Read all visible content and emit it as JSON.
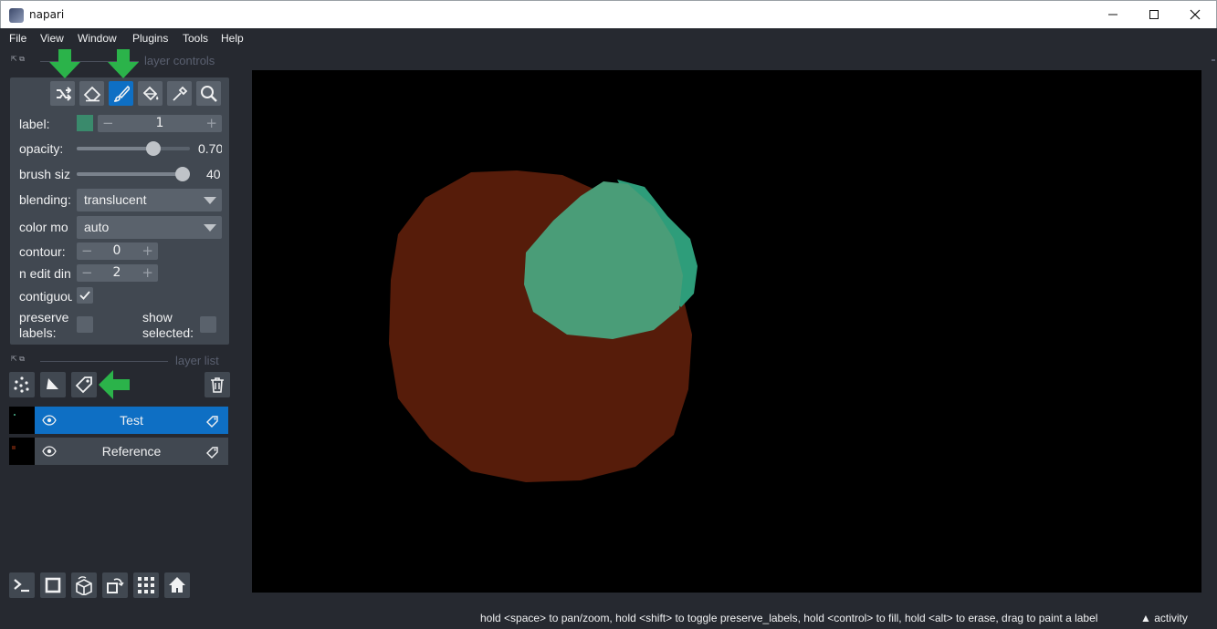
{
  "window": {
    "title": "napari"
  },
  "menu": [
    "File",
    "View",
    "Window",
    "Plugins",
    "Tools",
    "Help"
  ],
  "dock": {
    "layer_controls_title": "layer controls",
    "layer_list_title": "layer list"
  },
  "tools": [
    "shuffle-icon",
    "eraser-icon",
    "paintbrush-icon",
    "fill-bucket-icon",
    "color-picker-icon",
    "zoom-icon"
  ],
  "active_tool": "paintbrush-icon",
  "controls": {
    "label": {
      "title": "label:",
      "value": "1",
      "color": "#3a8a6c"
    },
    "opacity": {
      "title": "opacity:",
      "value": "0.70",
      "level": 0.7
    },
    "brush_size": {
      "title": "brush siz",
      "value": "40",
      "level": 1.0
    },
    "blending": {
      "title": "blending:",
      "value": "translucent"
    },
    "color_mode": {
      "title": "color mo",
      "value": "auto"
    },
    "contour": {
      "title": "contour:",
      "value": "0"
    },
    "n_edit_dim": {
      "title": "n edit din",
      "value": "2"
    },
    "contiguous": {
      "title": "contiguou",
      "checked": true
    },
    "preserve_labels": {
      "title_line1": "preserve",
      "title_line2": "labels:",
      "checked": false
    },
    "show_selected": {
      "title_line1": "show",
      "title_line2": "selected:",
      "checked": false
    }
  },
  "layers": [
    {
      "name": "Test",
      "selected": true,
      "type": "labels"
    },
    {
      "name": "Reference",
      "selected": false,
      "type": "labels"
    }
  ],
  "colors": {
    "accent": "#0e6fc4",
    "background": "#262930",
    "panel": "#414851",
    "arrow": "#2bb34a",
    "reference_label": "#561c0a",
    "test_label": "#4a9d78",
    "test_label_edge": "#2e9d7a"
  },
  "status": {
    "hint": "hold <space> to pan/zoom, hold <shift> to toggle preserve_labels, hold <control> to fill, hold <alt> to erase, drag to paint a label",
    "activity": "activity"
  }
}
